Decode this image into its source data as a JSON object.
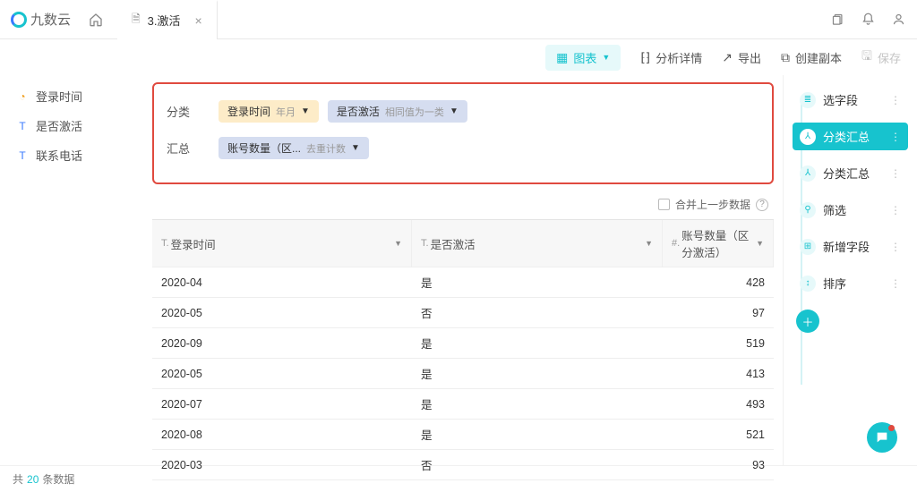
{
  "brand": "九数云",
  "tab": {
    "title": "3.激活"
  },
  "toolbar": {
    "chart": "图表",
    "detail": "分析详情",
    "export": "导出",
    "copy": "创建副本",
    "save": "保存"
  },
  "left_fields": [
    {
      "type": "clock",
      "glyph": "◔",
      "label": "登录时间"
    },
    {
      "type": "text",
      "glyph": "T",
      "label": "是否激活"
    },
    {
      "type": "text",
      "glyph": "T",
      "label": "联系电话"
    }
  ],
  "config": {
    "group_label": "分类",
    "agg_label": "汇总",
    "group_pills": [
      {
        "cls": "yellow",
        "text": "登录时间",
        "sub": "年月"
      },
      {
        "cls": "blue",
        "text": "是否激活",
        "sub": "相同值为一类"
      }
    ],
    "agg_pills": [
      {
        "cls": "blue",
        "text": "账号数量（区...",
        "sub": "去重计数"
      }
    ],
    "merge": "合并上一步数据"
  },
  "table": {
    "headers": [
      {
        "pre": "T.",
        "label": "登录时间"
      },
      {
        "pre": "T.",
        "label": "是否激活"
      },
      {
        "pre": "#.",
        "label": "账号数量（区分激活）"
      }
    ],
    "rows": [
      {
        "c1": "2020-04",
        "c2": "是",
        "c3": "428"
      },
      {
        "c1": "2020-05",
        "c2": "否",
        "c3": "97"
      },
      {
        "c1": "2020-09",
        "c2": "是",
        "c3": "519"
      },
      {
        "c1": "2020-05",
        "c2": "是",
        "c3": "413"
      },
      {
        "c1": "2020-07",
        "c2": "是",
        "c3": "493"
      },
      {
        "c1": "2020-08",
        "c2": "是",
        "c3": "521"
      },
      {
        "c1": "2020-03",
        "c2": "否",
        "c3": "93"
      }
    ]
  },
  "steps": [
    {
      "icon": "≣",
      "label": "选字段"
    },
    {
      "icon": "�branch",
      "label": "分类汇总",
      "active": true
    },
    {
      "icon": "�branch",
      "label": "分类汇总"
    },
    {
      "icon": "⚲",
      "label": "筛选"
    },
    {
      "icon": "⊞",
      "label": "新增字段"
    },
    {
      "icon": "↕",
      "label": "排序"
    }
  ],
  "footer": {
    "pre": "共",
    "count": "20",
    "suf": "条数据"
  }
}
